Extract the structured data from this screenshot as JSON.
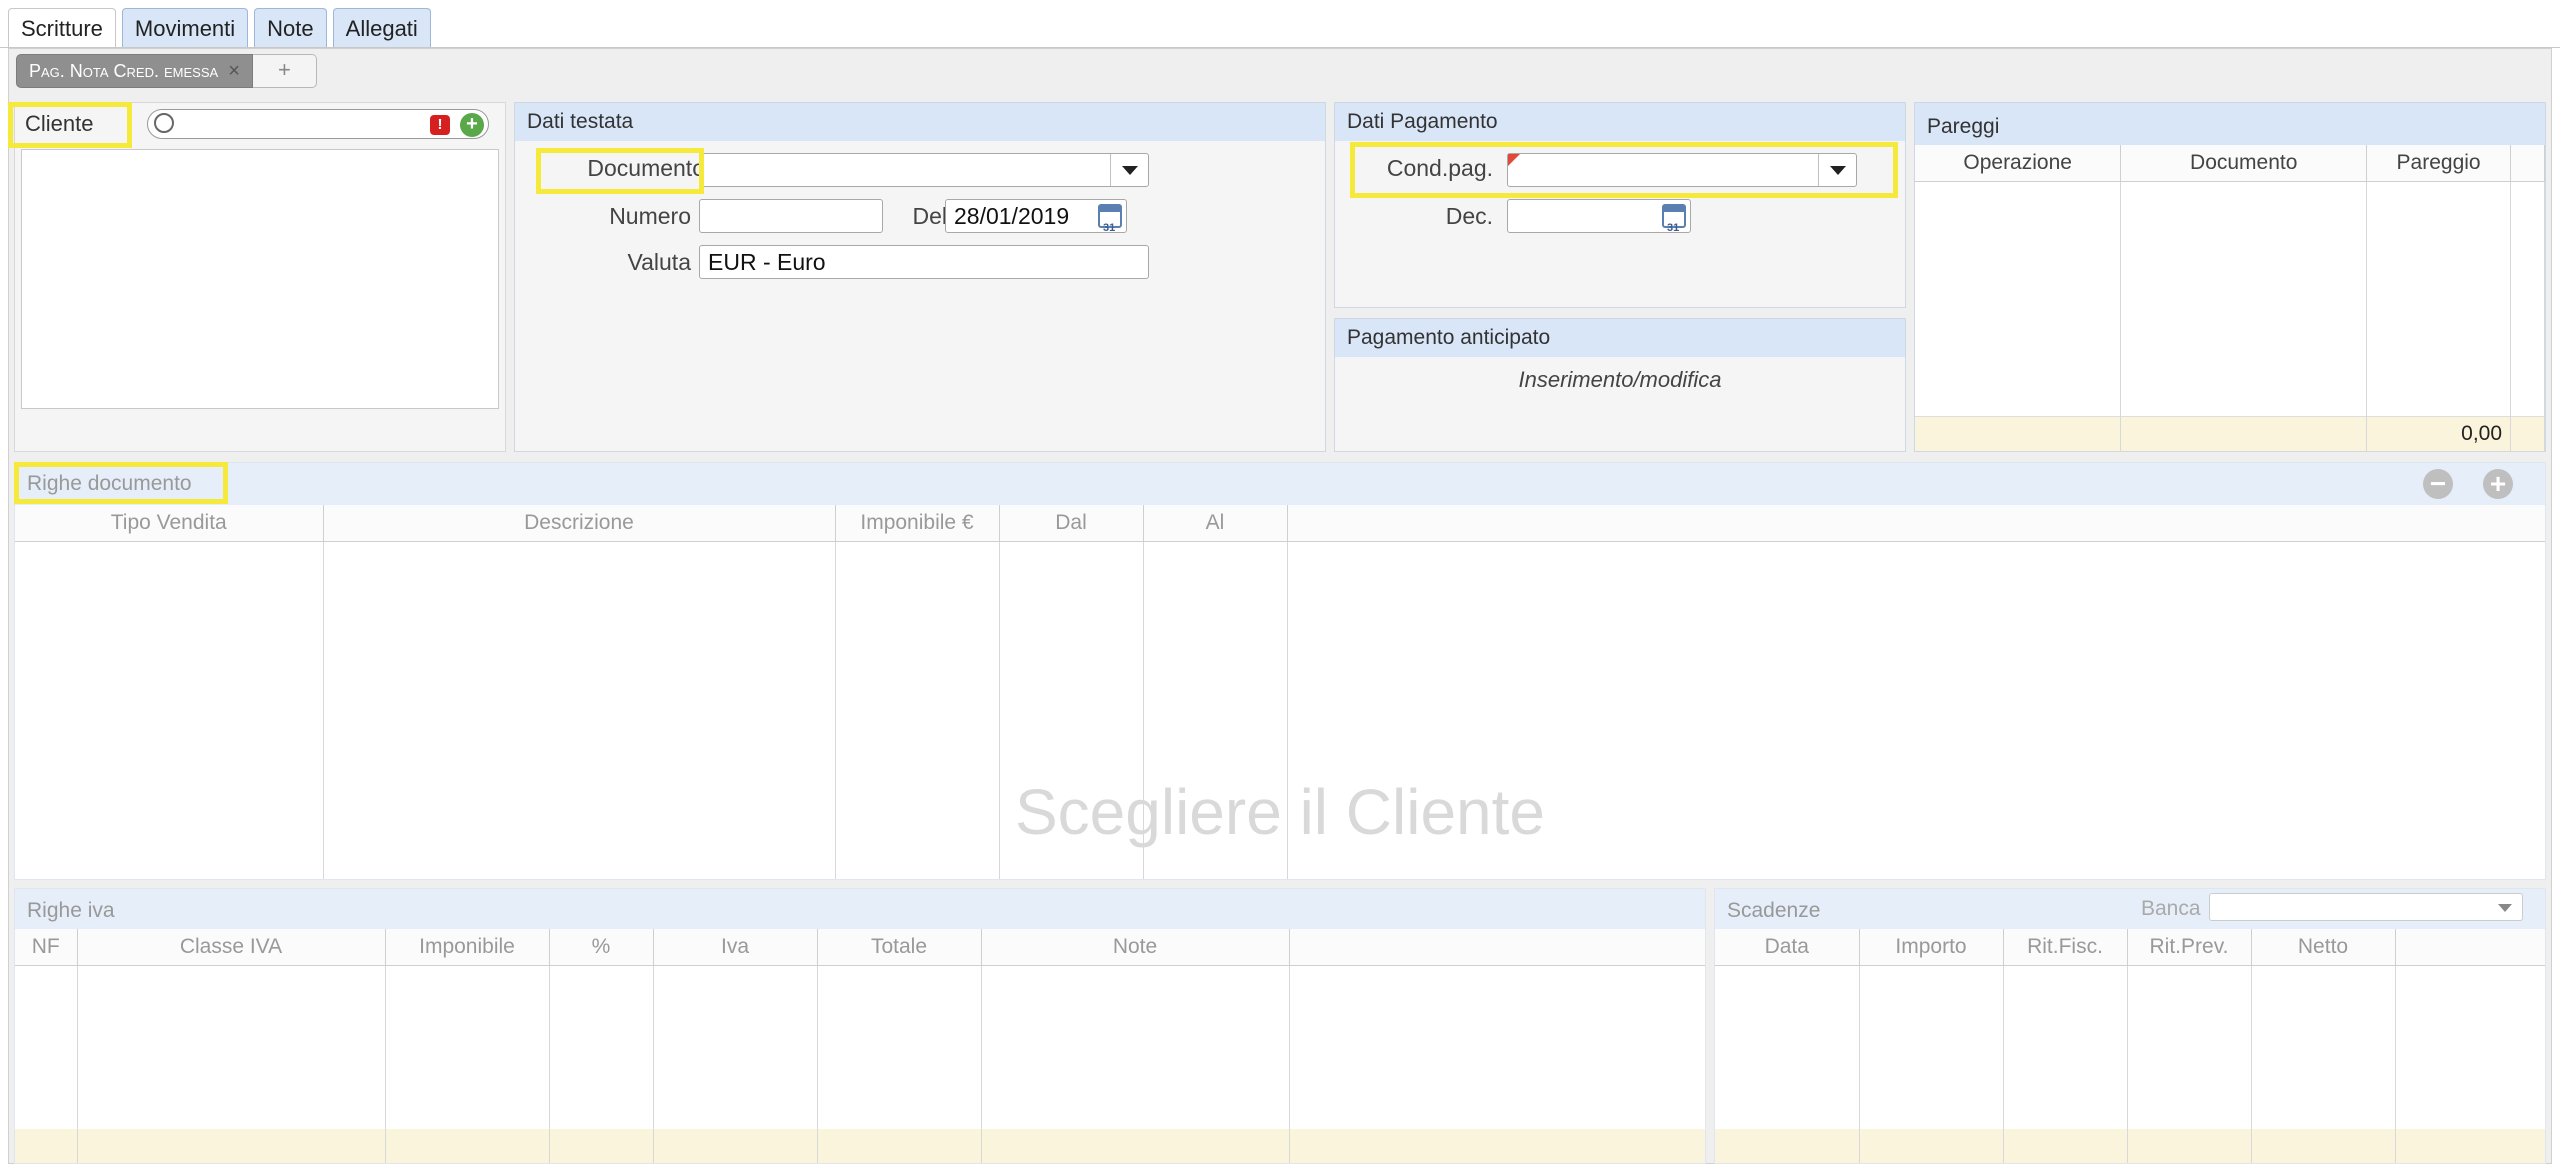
{
  "tabs": [
    "Scritture",
    "Movimenti",
    "Note",
    "Allegati"
  ],
  "subtab": {
    "label": "Pag. Nota Cred. emessa",
    "close": "×",
    "add": "+"
  },
  "cliente": {
    "label": "Cliente",
    "value": ""
  },
  "dati_testata": {
    "title": "Dati testata",
    "documento_label": "Documento",
    "documento_value": "",
    "numero_label": "Numero",
    "numero_value": "",
    "del_label": "Del",
    "del_value": "28/01/2019",
    "valuta_label": "Valuta",
    "valuta_value": "EUR - Euro"
  },
  "dati_pagamento": {
    "title": "Dati Pagamento",
    "condpag_label": "Cond.pag.",
    "condpag_value": "",
    "dec_label": "Dec.",
    "dec_value": ""
  },
  "pagamento_anticipato": {
    "title": "Pagamento anticipato",
    "text": "Inserimento/modifica"
  },
  "pareggi": {
    "title": "Pareggi",
    "columns": [
      "Operazione",
      "Documento",
      "Pareggio"
    ],
    "total": "0,00"
  },
  "righe_documento": {
    "title": "Righe documento",
    "columns": [
      "Tipo Vendita",
      "Descrizione",
      "Imponibile €",
      "Dal",
      "Al"
    ],
    "watermark": "Scegliere il Cliente"
  },
  "righe_iva": {
    "title": "Righe iva",
    "columns": [
      "NF",
      "Classe IVA",
      "Imponibile",
      "%",
      "Iva",
      "Totale",
      "Note"
    ]
  },
  "scadenze": {
    "title": "Scadenze",
    "banca_label": "Banca",
    "banca_value": "",
    "columns": [
      "Data",
      "Importo",
      "Rit.Fisc.",
      "Rit.Prev.",
      "Netto"
    ]
  }
}
